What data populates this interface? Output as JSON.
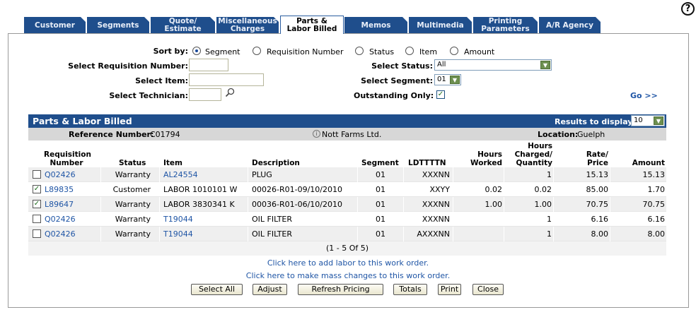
{
  "help_icon": "?",
  "tabs": [
    {
      "label": "Customer"
    },
    {
      "label": "Segments"
    },
    {
      "label": "Quote/ Estimate"
    },
    {
      "label": "Miscellaneous Charges"
    },
    {
      "label": "Parts & Labor Billed"
    },
    {
      "label": "Memos"
    },
    {
      "label": "Multimedia"
    },
    {
      "label": "Printing Parameters"
    },
    {
      "label": "A/R Agency"
    }
  ],
  "filters": {
    "sort_by_label": "Sort by:",
    "sort_options": [
      "Segment",
      "Requisition Number",
      "Status",
      "Item",
      "Amount"
    ],
    "sort_selected": "Segment",
    "req_number_label": "Select Requisition Number:",
    "req_number_value": "",
    "item_label": "Select Item:",
    "item_value": "",
    "tech_label": "Select Technician:",
    "tech_value": "",
    "status_label": "Select Status:",
    "status_value": "All",
    "segment_label": "Select Segment:",
    "segment_value": "01",
    "outstanding_label": "Outstanding Only:",
    "outstanding_checked": true,
    "go_link": "Go >>"
  },
  "grid": {
    "title": "Parts & Labor Billed",
    "results_label": "Results to display:",
    "results_value": "10",
    "reference_label": "Reference Number:",
    "reference_value": "C01794",
    "customer": "Nott Farms Ltd.",
    "location_label": "Location:",
    "location_value": "Guelph",
    "columns": {
      "req1": "Requisition",
      "req2": "Number",
      "status": "Status",
      "item": "Item",
      "description": "Description",
      "segment": "Segment",
      "ldtttn": "LDTTTTN",
      "hw1": "Hours",
      "hw2": "Worked",
      "hc1": "Hours",
      "hc2": "Charged/",
      "hc3": "Quantity",
      "rp1": "Rate/",
      "rp2": "Price",
      "amount": "Amount"
    },
    "rows": [
      {
        "req": "Q02426",
        "checked": false,
        "status": "Warranty",
        "item": "AL24554",
        "item_link": true,
        "description": "PLUG",
        "segment": "01",
        "ldtttn": "XXXNN",
        "worked": "",
        "charged": "1",
        "rate": "15.13",
        "amount": "15.13"
      },
      {
        "req": "L89835",
        "checked": true,
        "status": "Customer",
        "item": "LABOR 1010101 W",
        "item_link": false,
        "description": "00026-R01-09/10/2010",
        "segment": "01",
        "ldtttn": "XXYY",
        "worked": "0.02",
        "charged": "0.02",
        "rate": "85.00",
        "amount": "1.70"
      },
      {
        "req": "L89647",
        "checked": true,
        "status": "Warranty",
        "item": "LABOR 3830341 K",
        "item_link": false,
        "description": "00036-R01-06/10/2010",
        "segment": "01",
        "ldtttn": "XXXNN",
        "worked": "1.00",
        "charged": "1.00",
        "rate": "70.75",
        "amount": "70.75"
      },
      {
        "req": "Q02426",
        "checked": false,
        "status": "Warranty",
        "item": "T19044",
        "item_link": true,
        "description": "OIL FILTER",
        "segment": "01",
        "ldtttn": "XXXNN",
        "worked": "",
        "charged": "1",
        "rate": "6.16",
        "amount": "6.16"
      },
      {
        "req": "Q02426",
        "checked": false,
        "status": "Warranty",
        "item": "T19044",
        "item_link": true,
        "description": "OIL FILTER",
        "segment": "01",
        "ldtttn": "AXXXNN",
        "worked": "",
        "charged": "1",
        "rate": "8.00",
        "amount": "8.00"
      }
    ],
    "pager": "(1 - 5 Of 5)"
  },
  "links": {
    "add_labor": "Click here to add labor to this work order.",
    "mass_changes": "Click here to make mass changes to this work order."
  },
  "buttons": [
    "Select All",
    "Adjust",
    "Refresh Pricing",
    "Totals",
    "Print",
    "Close"
  ],
  "colors": {
    "header_bar": "#1f4e8c",
    "link": "#1f55a5",
    "sub_header": "#d7d7d7"
  }
}
